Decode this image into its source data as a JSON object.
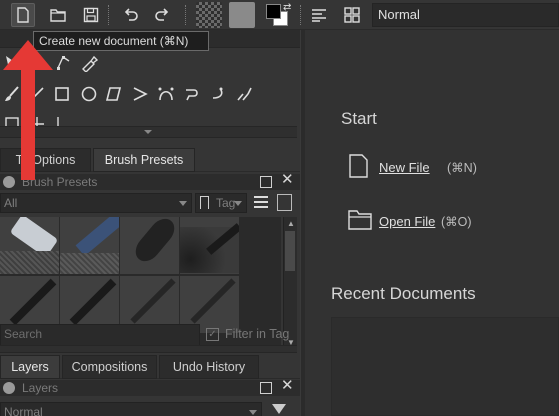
{
  "toolbar": {
    "mode": "Normal",
    "tooltip": "Create new document (⌘N)"
  },
  "dock": {
    "tool_options_tab": "Tool Options",
    "tool_options_tab_visible": "To   Options",
    "brush_presets_tab": "Brush Presets",
    "brush_presets_title": "Brush Presets",
    "filter_all": "All",
    "tag_label": "Tag",
    "search_placeholder": "Search",
    "filter_in_tag": "Filter in Tag",
    "layers_tab": "Layers",
    "compositions_tab": "Compositions",
    "undo_history_tab": "Undo History",
    "layers_title": "Layers",
    "blend_mode": "Normal"
  },
  "welcome": {
    "start_heading": "Start",
    "new_file": "New File",
    "new_file_shortcut": "(⌘N)",
    "open_file": "Open File",
    "open_file_shortcut": "(⌘O)",
    "recent_heading": "Recent Documents"
  },
  "colors": {
    "arrow": "#e53935",
    "panel_bg": "#353535",
    "dark_bg": "#2a2a2a"
  }
}
